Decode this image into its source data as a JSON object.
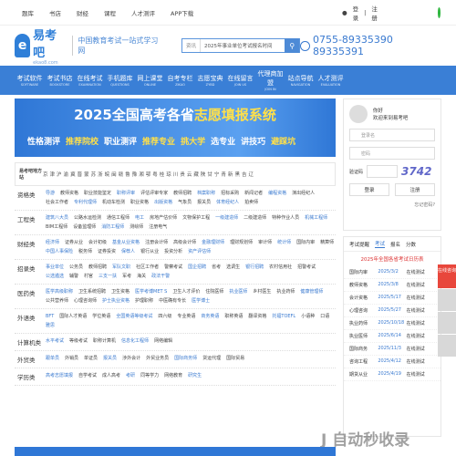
{
  "topbar": {
    "links": [
      "题库",
      "书店",
      "财经",
      "课程",
      "人才测评",
      "APP下载"
    ],
    "login": "登录",
    "register": "注册"
  },
  "logo": {
    "name": "易考吧",
    "url_text": "ekao8.com",
    "slogan": "中国教育考试一站式学习网"
  },
  "search": {
    "category": "资讯",
    "placeholder": "2025年事业单位考试报名时间"
  },
  "phone": "0755-89335390 89335391",
  "nav": [
    {
      "t": "考试软件",
      "e": "SOFTWARE"
    },
    {
      "t": "考试书店",
      "e": "BOOKSTORE"
    },
    {
      "t": "在线考试",
      "e": "EXAMINATION"
    },
    {
      "t": "手机题库",
      "e": "QUESTIONS"
    },
    {
      "t": "网上课堂",
      "e": "ONLINE"
    },
    {
      "t": "自考专栏",
      "e": "ZIKAO"
    },
    {
      "t": "志愿宝典",
      "e": "ZYBD"
    },
    {
      "t": "在线留言",
      "e": "JOIN US"
    },
    {
      "t": "代理商加盟",
      "e": "JOIN IN"
    },
    {
      "t": "站点导航",
      "e": "NAVIGATION"
    },
    {
      "t": "人才测评",
      "e": "EVALUATION"
    }
  ],
  "banner": {
    "title_a": "2025全国高考各省",
    "title_b": "志愿填报系统",
    "row": [
      "性格测评",
      "推荐院校",
      "职业测评",
      "推荐专业",
      "挑大学",
      "选专业",
      "讲技巧",
      "避踩坑"
    ]
  },
  "region": {
    "label": "易考吧地方站",
    "list": [
      "京",
      "津",
      "沪",
      "渝",
      "冀",
      "晋",
      "蒙",
      "苏",
      "浙",
      "皖",
      "闽",
      "赣",
      "鲁",
      "豫",
      "湘",
      "鄂",
      "粤",
      "桂",
      "琼",
      "川",
      "贵",
      "云",
      "藏",
      "陕",
      "甘",
      "宁",
      "青",
      "新",
      "黑",
      "吉",
      "辽"
    ]
  },
  "categories": [
    {
      "name": "资格类",
      "items": [
        "导游",
        "教师资格",
        "职业技能鉴定",
        "职称评审",
        "评估评审专家",
        "教师招聘",
        "档案职称",
        "招标采购",
        "新闻记者",
        "编程资格",
        "演出经纪人",
        "社会工作者",
        "专利代理师",
        "机动车检测",
        "职业资格",
        "出版资格",
        "气象员",
        "报关员",
        "体育经纪人",
        "拍卖师"
      ]
    },
    {
      "name": "工程类",
      "items": [
        "建筑八大员",
        "公路水运检测",
        "通信工程师",
        "电工",
        "房地产估价师",
        "文物保护工程",
        "一级建造师",
        "二级建造师",
        "特种作业人员",
        "机械工程师",
        "BIM工程师",
        "设备监理师",
        "消防工程师",
        "测绘师",
        "注册电气"
      ]
    },
    {
      "name": "财经类",
      "items": [
        "经济师",
        "证券从业",
        "会计初级",
        "基金从业资格",
        "注册会计师",
        "高级会计师",
        "金融理财师",
        "理财规划师",
        "审计师",
        "统计师",
        "国际内审",
        "精算师",
        "中国人事保险",
        "税务师",
        "证券投资",
        "保荐人",
        "银行从业",
        "投资分析",
        "资产评估师"
      ]
    },
    {
      "name": "招录类",
      "items": [
        "事业单位",
        "公务员",
        "教师招聘",
        "军队文职",
        "社区工作者",
        "警察考试",
        "国企招聘",
        "省考",
        "选调生",
        "银行招聘",
        "农村信用社",
        "招警考试",
        "公选遴选",
        "辅警",
        "村官",
        "三支一扶",
        "军考",
        "海关",
        "政法干警"
      ]
    },
    {
      "name": "医药类",
      "items": [
        "医学高级职称",
        "卫生系统招聘",
        "卫生资格",
        "医学考博MET S",
        "卫生人才评价",
        "住院医师",
        "执业医师",
        "乡村医生",
        "执业药师",
        "健康管理师",
        "公共营养师",
        "心理咨询师",
        "护士执业资格",
        "护理职称",
        "中医确有专长",
        "医学博士"
      ]
    },
    {
      "name": "外语类",
      "items": [
        "BFT",
        "国际人才英语",
        "学位英语",
        "全国英语等级考试",
        "四六级",
        "专业英语",
        "商务英语",
        "职称英语",
        "翻译资格",
        "托福TOEFL",
        "小语种",
        "口语",
        "雅思"
      ]
    },
    {
      "name": "计算机类",
      "items": [
        "水平考试",
        "等级考试",
        "职称计算机",
        "信息化工程师",
        "网络编辑"
      ]
    },
    {
      "name": "外贸类",
      "items": [
        "跟单员",
        "外销员",
        "单证员",
        "报关员",
        "涉外会计",
        "外贸业务员",
        "国际商务师",
        "货运代理",
        "国际贸易"
      ]
    },
    {
      "name": "学历类",
      "items": [
        "高考志愿填报",
        "自学考试",
        "成人高考",
        "考研",
        "同等学力",
        "网络教育",
        "研究生"
      ]
    }
  ],
  "login_box": {
    "greeting": "你好",
    "welcome": "欢迎来到易考吧",
    "username": "登录名",
    "password": "密码",
    "captcha_label": "验证码",
    "captcha_code": "3742",
    "login_btn": "登录",
    "register_btn": "注册",
    "forget": "忘记密码?"
  },
  "calendar": {
    "tabs": [
      "考试提醒",
      "考试",
      "报名",
      "分数"
    ],
    "title": "2025年全国各省考试日历表",
    "rows": [
      [
        "国际内审",
        "2025/3/2",
        "在线测试"
      ],
      [
        "教师资格",
        "2025/3/8",
        "在线测试"
      ],
      [
        "会计资格",
        "2025/5/17",
        "在线测试"
      ],
      [
        "心理咨询",
        "2025/5/27",
        "在线测试"
      ],
      [
        "执业药师",
        "2025/10/18",
        "在线测试"
      ],
      [
        "执业医师",
        "2025/6/14",
        "在线测试"
      ],
      [
        "国际商务",
        "2025/11/3",
        "在线测试"
      ],
      [
        "咨询工程",
        "2025/4/12",
        "在线测试"
      ],
      [
        "期货从业",
        "2025/4/19",
        "在线测试"
      ]
    ]
  },
  "side": {
    "online": "在线咨询"
  },
  "watermark": "J 自动秒收录"
}
